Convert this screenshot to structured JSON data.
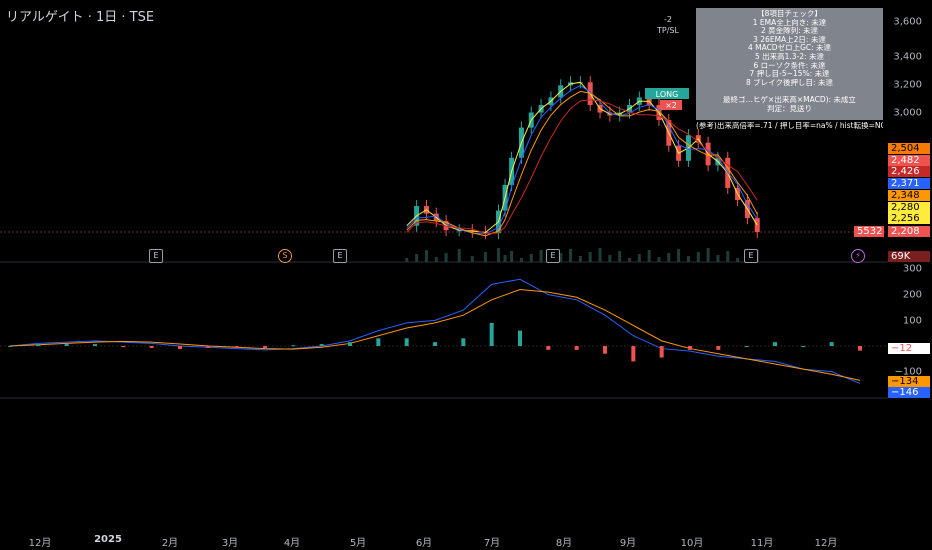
{
  "header": {
    "title": "リアルゲイト · 1日 · TSE"
  },
  "colors": {
    "bg": "#000000",
    "up": "#26a69a",
    "down": "#ef5350"
  },
  "note": {
    "lines": [
      "【8項目チェック】",
      "1 EMA全上向き: 未達",
      "2 黄金隊列: 未達",
      "3 26EMA上2日: 未達",
      "4 MACDゼロ上GC: 未達",
      "5 出来高1.3-2: 未達",
      "6 ローソク条件: 未達",
      "7 押し目-5~15%: 未達",
      "8 ブレイク後押し目: 未達",
      "",
      "最終ゴ…ヒゲ×出来高×MACD): 未成立",
      "判定：見送り",
      "",
      "(参考)出来高倍率=.71 / 押し目率=na% / hist転換=NO"
    ]
  },
  "markers": {
    "tp_sl": "TP/SL",
    "minus2": "-2",
    "long": "LONG",
    "exit": "×2"
  },
  "events": [
    {
      "label": "E",
      "type": "earnings"
    },
    {
      "label": "S",
      "type": "split"
    },
    {
      "label": "E",
      "type": "earnings"
    },
    {
      "label": "E",
      "type": "earnings"
    },
    {
      "label": "E",
      "type": "earnings"
    },
    {
      "label": "⚡",
      "type": "alert"
    }
  ],
  "price_tags": [
    {
      "text": "2,504",
      "bg": "#f57c00",
      "fg": "#000000"
    },
    {
      "text": "2,482",
      "bg": "#ef5350",
      "fg": "#ffffff"
    },
    {
      "text": "2,426",
      "bg": "#c62828",
      "fg": "#ffffff"
    },
    {
      "text": "2,371",
      "bg": "#2962ff",
      "fg": "#ffffff"
    },
    {
      "text": "2,348",
      "bg": "#ff9800",
      "fg": "#000000"
    },
    {
      "text": "2,280",
      "bg": "#ffeb3b",
      "fg": "#000000"
    },
    {
      "text": "2,256",
      "bg": "#ffeb3b",
      "fg": "#000000"
    },
    {
      "text": "2,208",
      "bg": "#ef5350",
      "fg": "#ffffff"
    }
  ],
  "countdown": "5532",
  "volume_tag": "69K",
  "macd_tags": [
    {
      "text": "−12",
      "bg": "#ffffff",
      "fg": "#ef5350"
    },
    {
      "text": "−134",
      "bg": "#ff9800",
      "fg": "#000000"
    },
    {
      "text": "−146",
      "bg": "#2962ff",
      "fg": "#ffffff"
    }
  ],
  "chart_data": [
    {
      "type": "candlestick",
      "title": "リアルゲイト · 1日 · TSE",
      "x_ticks": [
        "12月",
        "2025",
        "2月",
        "3月",
        "4月",
        "5月",
        "6月",
        "7月",
        "8月",
        "9月",
        "10月",
        "11月",
        "12月"
      ],
      "y_ticks": [
        "3,600",
        "3,400",
        "3,200",
        "3,000"
      ],
      "y_range": [
        2150,
        3650
      ],
      "last_price": 2208,
      "series_approx": {
        "x_month_index": [
          5.6,
          5.75,
          5.9,
          6.05,
          6.2,
          6.4,
          6.6,
          6.8,
          7.0,
          7.1,
          7.2,
          7.35,
          7.5,
          7.65,
          7.8,
          7.95,
          8.1,
          8.25,
          8.4,
          8.55,
          8.7,
          8.85,
          9.0,
          9.15,
          9.3,
          9.45,
          9.6,
          9.75,
          9.9,
          10.05,
          10.2,
          10.35,
          10.5,
          10.65,
          10.8,
          10.95
        ],
        "close": [
          2250,
          2380,
          2330,
          2280,
          2220,
          2220,
          2210,
          2200,
          2350,
          2520,
          2700,
          2900,
          3000,
          3050,
          3100,
          3180,
          3200,
          3200,
          3050,
          3000,
          2980,
          3000,
          3050,
          3100,
          3050,
          2950,
          2780,
          2680,
          2850,
          2800,
          2650,
          2700,
          2500,
          2420,
          2300,
          2208
        ]
      },
      "ema_lines": [
        {
          "color": "#ffeb3b"
        },
        {
          "color": "#2962ff"
        },
        {
          "color": "#ff9800"
        },
        {
          "color": "#c62828"
        }
      ]
    },
    {
      "type": "line",
      "title": "MACD",
      "y_ticks": [
        "300",
        "200",
        "100",
        "−100"
      ],
      "y_range": [
        -170,
        300
      ],
      "series": [
        {
          "color": "#2962ff",
          "values": [
            0,
            10,
            15,
            20,
            15,
            10,
            0,
            -5,
            -10,
            -15,
            -10,
            0,
            20,
            60,
            90,
            100,
            140,
            240,
            260,
            200,
            180,
            120,
            40,
            -10,
            -20,
            -40,
            -50,
            -60,
            -90,
            -100,
            -146
          ]
        },
        {
          "color": "#ff9800",
          "values": [
            0,
            5,
            10,
            15,
            18,
            15,
            8,
            0,
            -5,
            -10,
            -12,
            -5,
            10,
            40,
            70,
            90,
            120,
            180,
            220,
            210,
            190,
            140,
            80,
            20,
            -10,
            -30,
            -50,
            -70,
            -90,
            -110,
            -134
          ]
        }
      ],
      "histogram_last": -12
    }
  ]
}
